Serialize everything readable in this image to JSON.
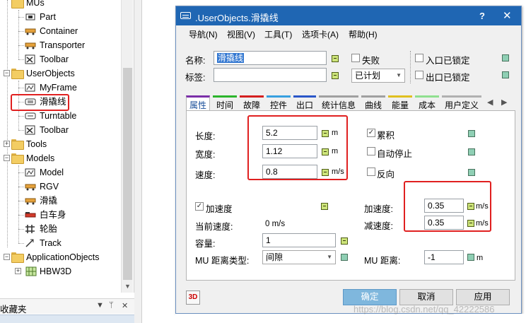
{
  "tree": {
    "items": [
      {
        "label": "MUs"
      },
      {
        "label": "Part"
      },
      {
        "label": "Container"
      },
      {
        "label": "Transporter"
      },
      {
        "label": "Toolbar"
      },
      {
        "label": "UserObjects"
      },
      {
        "label": "MyFrame"
      },
      {
        "label": "滑撬线"
      },
      {
        "label": "Turntable"
      },
      {
        "label": "Toolbar"
      },
      {
        "label": "Tools"
      },
      {
        "label": "Models"
      },
      {
        "label": "Model"
      },
      {
        "label": "RGV"
      },
      {
        "label": "滑撬"
      },
      {
        "label": "白车身"
      },
      {
        "label": "轮胎"
      },
      {
        "label": "Track"
      },
      {
        "label": "ApplicationObjects"
      },
      {
        "label": "HBW3D"
      }
    ],
    "favorites_title": "收藏夹",
    "favorites_buttons": [
      "▼",
      "ᛘ",
      "✕"
    ]
  },
  "dialog": {
    "title": ".UserObjects.滑撬线",
    "help": "?",
    "close": "✕",
    "menu": [
      "导航(N)",
      "视图(V)",
      "工具(T)",
      "选项卡(A)",
      "帮助(H)"
    ],
    "name_label": "名称:",
    "name_value": "滑撬线",
    "tag_label": "标签:",
    "tag_value": "",
    "failed_label": "失败",
    "planned_value": "已计划",
    "entry_locked_label": "入口已锁定",
    "exit_locked_label": "出口已锁定",
    "tabs": [
      "属性",
      "时间",
      "故障",
      "控件",
      "出口",
      "统计信息",
      "曲线",
      "能量",
      "成本",
      "用户定义"
    ],
    "tab_colors": [
      "#7b2fa8",
      "#2cb52c",
      "#d42020",
      "#37a0e0",
      "#2a56c8",
      "#a0a0a0",
      "#a0a0a0",
      "#e0c020",
      "#90e090",
      "#b0b0b0"
    ],
    "tab_nav": [
      "◀",
      "▶"
    ],
    "length_label": "长度:",
    "length_value": "5.2",
    "length_unit": "m",
    "width_label": "宽度:",
    "width_value": "1.12",
    "width_unit": "m",
    "speed_label": "速度:",
    "speed_value": "0.8",
    "speed_unit": "m/s",
    "accumulating_label": "累积",
    "accumulating_checked": true,
    "auto_stop_label": "自动停止",
    "auto_stop_checked": false,
    "reverse_label": "反向",
    "reverse_checked": false,
    "acceleration_check_label": "加速度",
    "acceleration_checked": true,
    "current_speed_label": "当前速度:",
    "current_speed_value": "0 m/s",
    "accel_label": "加速度:",
    "accel_value": "0.35",
    "accel_unit": "m/s",
    "decel_label": "减速度:",
    "decel_value": "0.35",
    "decel_unit": "m/s",
    "capacity_label": "容量:",
    "capacity_value": "1",
    "mu_distance_type_label": "MU 距离类型:",
    "mu_distance_type_value": "间隙",
    "mu_distance_label": "MU 距离:",
    "mu_distance_value": "-1",
    "mu_distance_unit": "m",
    "btn_3d": "3D",
    "ok": "确定",
    "cancel": "取消",
    "apply": "应用"
  },
  "watermark": "https://blog.csdn.net/qq_42222586"
}
